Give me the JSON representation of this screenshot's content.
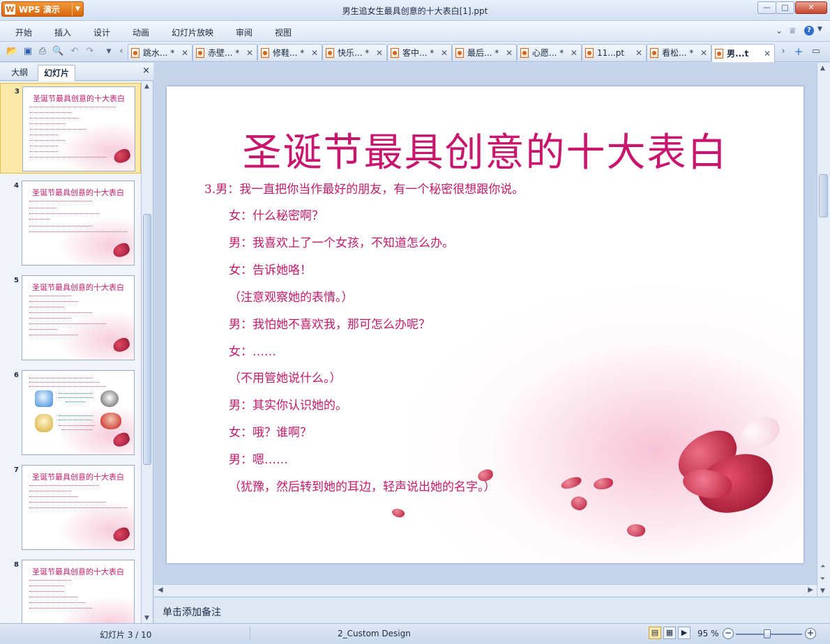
{
  "window": {
    "app_button": "WPS 演示",
    "title": "男生追女生最具创意的十大表白[1].ppt",
    "controls": {
      "minimize": "—",
      "maximize": "□",
      "close": "✕"
    }
  },
  "menu": {
    "items": [
      "开始",
      "插入",
      "设计",
      "动画",
      "幻灯片放映",
      "审阅",
      "视图"
    ],
    "right": {
      "collapse": "⌄",
      "skin": "♕",
      "help": "?"
    }
  },
  "tabs": [
    {
      "label": "跳水...",
      "modified": "*"
    },
    {
      "label": "赤壁...",
      "modified": "*"
    },
    {
      "label": "修鞋...",
      "modified": "*"
    },
    {
      "label": "快乐...",
      "modified": "*"
    },
    {
      "label": "客中...",
      "modified": "*"
    },
    {
      "label": "最后...",
      "modified": "*"
    },
    {
      "label": "心愿...",
      "modified": "*"
    },
    {
      "label": "11...pt",
      "modified": ""
    },
    {
      "label": "看松...",
      "modified": "*"
    },
    {
      "label": "男...t",
      "modified": "",
      "active": true
    }
  ],
  "left_panel": {
    "tab_outline": "大纲",
    "tab_slides": "幻灯片",
    "close": "×",
    "thumbnails": [
      {
        "number": "3",
        "title": "圣诞节最具创意的十大表白",
        "selected": true
      },
      {
        "number": "4",
        "title": "圣诞节最具创意的十大表白"
      },
      {
        "number": "5",
        "title": "圣诞节最具创意的十大表白"
      },
      {
        "number": "6",
        "title": ""
      },
      {
        "number": "7",
        "title": "圣诞节最具创意的十大表白"
      },
      {
        "number": "8",
        "title": "圣诞节最具创意的十大表白"
      }
    ]
  },
  "slide": {
    "title": "圣诞节最具创意的十大表白",
    "lines": [
      "3.男：我一直把你当作最好的朋友，有一个秘密很想跟你说。",
      "女：什么秘密啊？",
      "男：我喜欢上了一个女孩，不知道怎么办。",
      "女：告诉她咯！",
      "（注意观察她的表情。）",
      "男：我怕她不喜欢我，那可怎么办呢？",
      "女：……",
      "（不用管她说什么。）",
      "男：其实你认识她的。",
      "女：哦？谁啊？",
      "男：嗯……",
      "（犹豫，然后转到她的耳边，轻声说出她的名字。）"
    ]
  },
  "notes": {
    "placeholder": "单击添加备注"
  },
  "status": {
    "slide_indicator": "幻灯片 3 / 10",
    "design": "2_Custom Design",
    "zoom": "95 %",
    "zoom_minus": "−",
    "zoom_plus": "+"
  },
  "colors": {
    "accent_pink": "#c8166f",
    "chrome_blue": "#cfdcee",
    "app_orange": "#d8660d"
  }
}
